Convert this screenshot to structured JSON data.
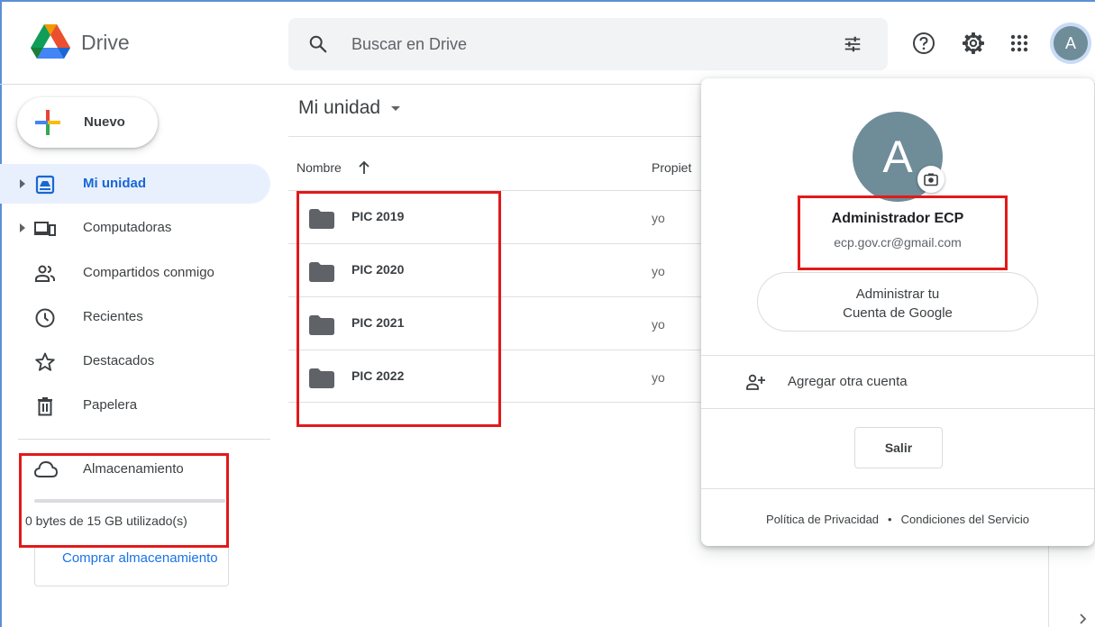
{
  "header": {
    "app_title": "Drive",
    "search_placeholder": "Buscar en Drive",
    "avatar_letter": "A"
  },
  "sidebar": {
    "new_label": "Nuevo",
    "items": [
      {
        "label": "Mi unidad",
        "icon": "drive-icon",
        "active": true
      },
      {
        "label": "Computadoras",
        "icon": "computers-icon"
      },
      {
        "label": "Compartidos conmigo",
        "icon": "shared-icon"
      },
      {
        "label": "Recientes",
        "icon": "clock-icon"
      },
      {
        "label": "Destacados",
        "icon": "star-icon"
      },
      {
        "label": "Papelera",
        "icon": "trash-icon"
      }
    ],
    "storage": {
      "label": "Almacenamiento",
      "used_text": "0 bytes de 15 GB utilizado(s)",
      "used_fraction": 0,
      "buy_label": "Comprar almacenamiento"
    }
  },
  "main": {
    "breadcrumb": "Mi unidad",
    "columns": {
      "name": "Nombre",
      "owner": "Propiet"
    },
    "files": [
      {
        "name": "PIC 2019",
        "owner": "yo"
      },
      {
        "name": "PIC 2020",
        "owner": "yo"
      },
      {
        "name": "PIC 2021",
        "owner": "yo"
      },
      {
        "name": "PIC 2022",
        "owner": "yo"
      }
    ]
  },
  "account_popup": {
    "avatar_letter": "A",
    "name": "Administrador ECP",
    "email": "ecp.gov.cr@gmail.com",
    "manage_line1": "Administrar tu",
    "manage_line2": "Cuenta de Google",
    "add_account": "Agregar otra cuenta",
    "sign_out": "Salir",
    "privacy": "Política de Privacidad",
    "separator": "•",
    "terms": "Condiciones del Servicio"
  },
  "colors": {
    "accent_blue": "#1a73e8",
    "active_bg": "#e8f0fe",
    "highlight_red": "#e11a1a",
    "avatar_bg": "#6f8c99"
  }
}
